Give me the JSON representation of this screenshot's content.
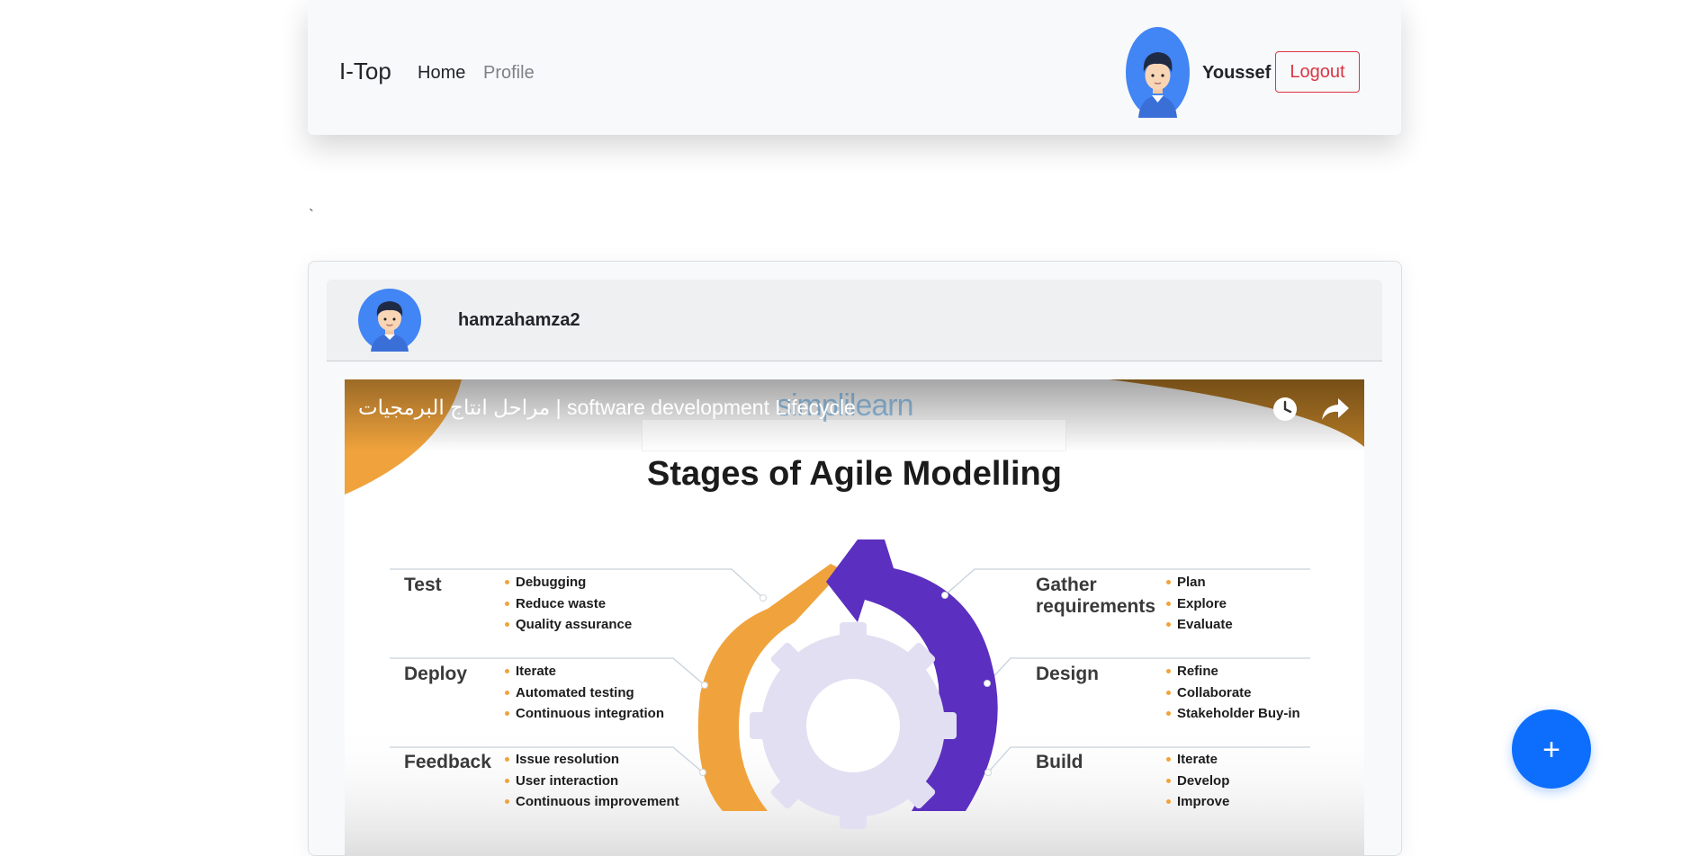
{
  "navbar": {
    "brand": "I-Top",
    "links": [
      {
        "label": "Home"
      },
      {
        "label": "Profile"
      }
    ],
    "username": "Youssef",
    "logout_label": "Logout"
  },
  "stray_text": "`",
  "post": {
    "author": "hamzahamza2",
    "video": {
      "title": "مراحل انتاج البرمجيات | software development Lifecycle",
      "watermark": "simplilearn",
      "slide_title": "Stages of Agile Modelling",
      "stages": [
        {
          "name": "Test",
          "items": [
            "Debugging",
            "Reduce waste",
            "Quality assurance"
          ]
        },
        {
          "name": "Deploy",
          "items": [
            "Iterate",
            "Automated testing",
            "Continuous integration"
          ]
        },
        {
          "name": "Feedback",
          "items": [
            "Issue resolution",
            "User interaction",
            "Continuous improvement"
          ]
        },
        {
          "name": "Gather requirements",
          "items": [
            "Plan",
            "Explore",
            "Evaluate"
          ]
        },
        {
          "name": "Design",
          "items": [
            "Refine",
            "Collaborate",
            "Stakeholder Buy-in"
          ]
        },
        {
          "name": "Build",
          "items": [
            "Iterate",
            "Develop",
            "Improve"
          ]
        }
      ]
    }
  },
  "fab_label": "+",
  "colors": {
    "primary": "#0d6efd",
    "danger": "#dc3545",
    "avatar_bg": "#4285f4",
    "cycle_orange": "#f0a33c",
    "cycle_purple": "#5b2fbf"
  },
  "icons": [
    "user-avatar-icon",
    "clock-icon",
    "share-icon",
    "gear-icon",
    "plus-icon"
  ]
}
